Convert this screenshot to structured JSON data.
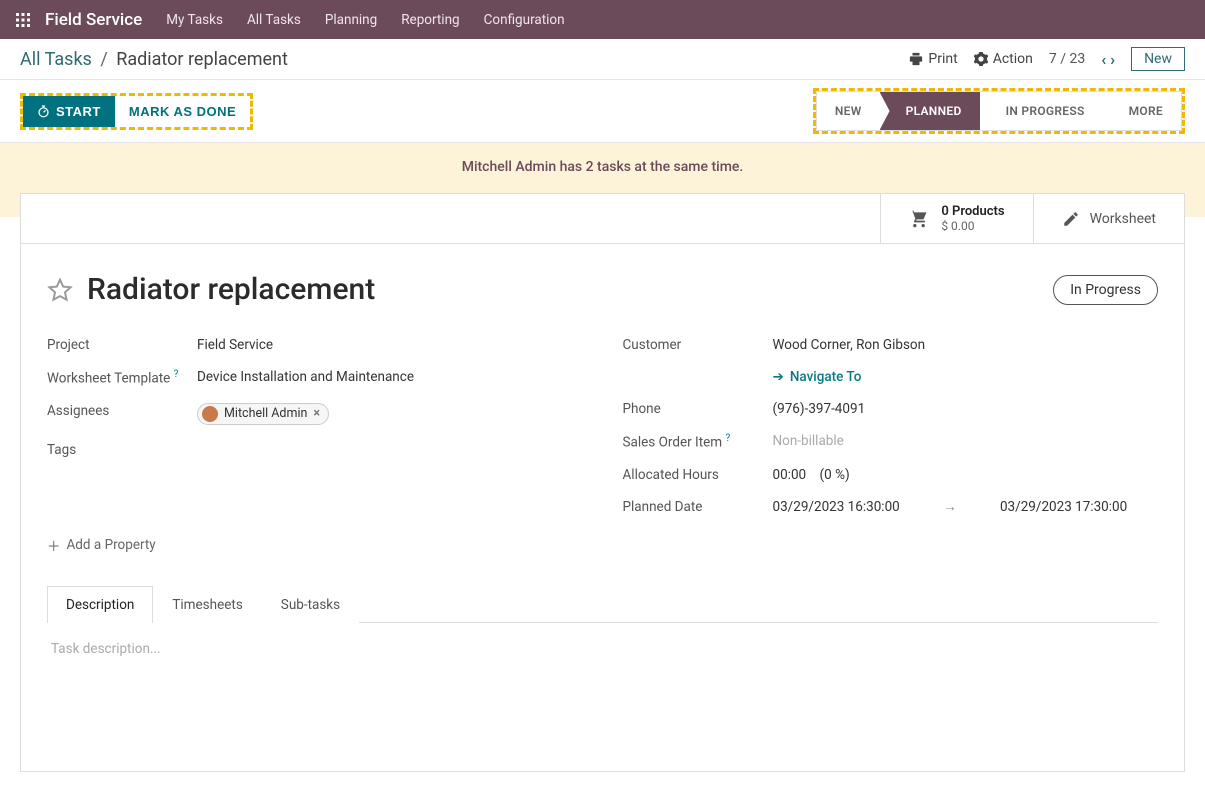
{
  "navbar": {
    "brand": "Field Service",
    "items": [
      "My Tasks",
      "All Tasks",
      "Planning",
      "Reporting",
      "Configuration"
    ]
  },
  "breadcrumb": {
    "parent": "All Tasks",
    "current": "Radiator replacement"
  },
  "topActions": {
    "print": "Print",
    "action": "Action",
    "pager": "7 / 23",
    "new": "New"
  },
  "buttons": {
    "start": "START",
    "done": "MARK AS DONE"
  },
  "stages": {
    "s0": "NEW",
    "s1": "PLANNED",
    "s2": "IN PROGRESS",
    "s3": "MORE"
  },
  "warning": "Mitchell Admin has 2 tasks at the same time.",
  "statbox": {
    "products_line1": "0 Products",
    "products_line2": "$ 0.00",
    "worksheet": "Worksheet"
  },
  "task": {
    "title": "Radiator replacement",
    "status": "In Progress",
    "labels": {
      "project": "Project",
      "worksheet_tpl": "Worksheet Template",
      "assignees": "Assignees",
      "tags": "Tags",
      "customer": "Customer",
      "phone": "Phone",
      "so_item": "Sales Order Item",
      "alloc_hours": "Allocated Hours",
      "planned_date": "Planned Date",
      "navigate": "Navigate To"
    },
    "values": {
      "project": "Field Service",
      "worksheet_tpl": "Device Installation and Maintenance",
      "assignee_name": "Mitchell Admin",
      "customer": "Wood Corner, Ron Gibson",
      "phone": "(976)-397-4091",
      "so_item": "Non-billable",
      "alloc_hours": "00:00",
      "alloc_pct": "(0 %)",
      "planned_from": "03/29/2023 16:30:00",
      "planned_to": "03/29/2023 17:30:00"
    },
    "add_property": "Add a Property"
  },
  "tabs": {
    "t0": "Description",
    "t1": "Timesheets",
    "t2": "Sub-tasks"
  },
  "desc_placeholder": "Task description..."
}
